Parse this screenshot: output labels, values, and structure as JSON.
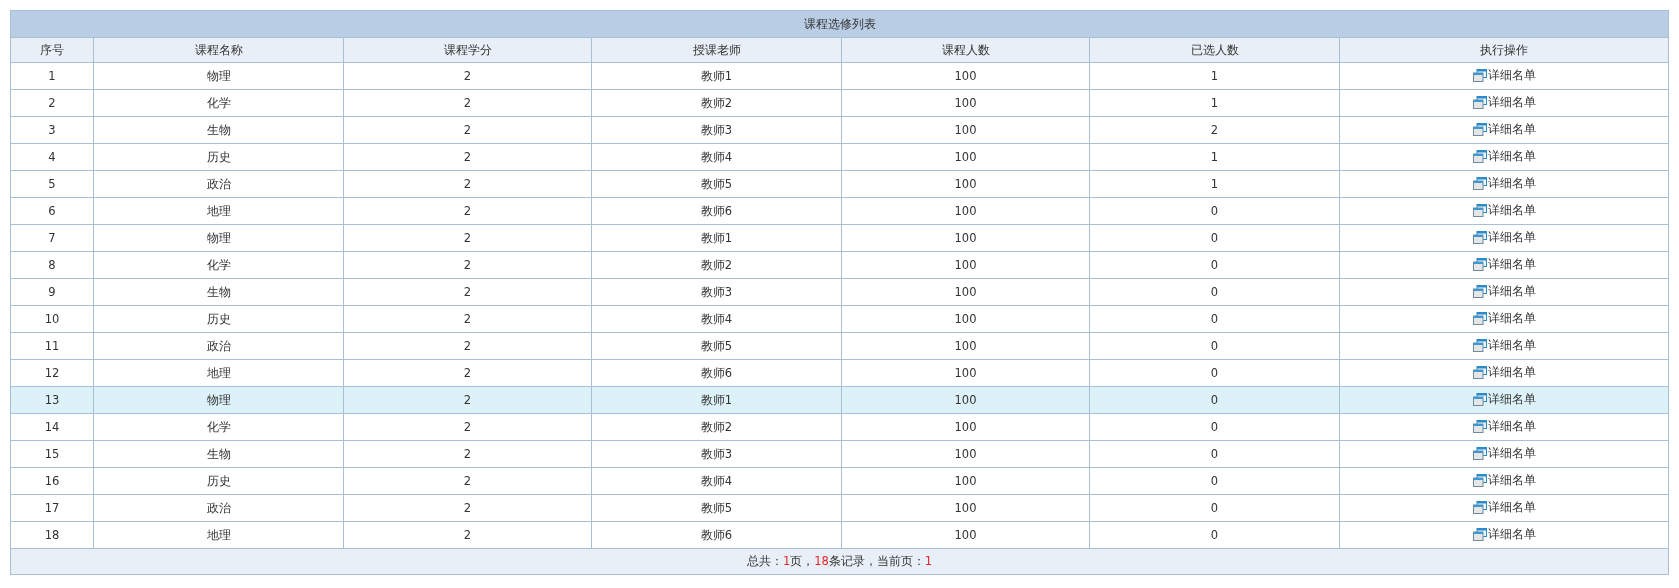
{
  "table": {
    "title": "课程选修列表",
    "columns": [
      "序号",
      "课程名称",
      "课程学分",
      "授课老师",
      "课程人数",
      "已选人数",
      "执行操作"
    ],
    "rows": [
      {
        "cells": [
          "1",
          "物理",
          "2",
          "教师1",
          "100",
          "1"
        ],
        "action": "详细名单",
        "highlighted": false
      },
      {
        "cells": [
          "2",
          "化学",
          "2",
          "教师2",
          "100",
          "1"
        ],
        "action": "详细名单",
        "highlighted": false
      },
      {
        "cells": [
          "3",
          "生物",
          "2",
          "教师3",
          "100",
          "2"
        ],
        "action": "详细名单",
        "highlighted": false
      },
      {
        "cells": [
          "4",
          "历史",
          "2",
          "教师4",
          "100",
          "1"
        ],
        "action": "详细名单",
        "highlighted": false
      },
      {
        "cells": [
          "5",
          "政治",
          "2",
          "教师5",
          "100",
          "1"
        ],
        "action": "详细名单",
        "highlighted": false
      },
      {
        "cells": [
          "6",
          "地理",
          "2",
          "教师6",
          "100",
          "0"
        ],
        "action": "详细名单",
        "highlighted": false
      },
      {
        "cells": [
          "7",
          "物理",
          "2",
          "教师1",
          "100",
          "0"
        ],
        "action": "详细名单",
        "highlighted": false
      },
      {
        "cells": [
          "8",
          "化学",
          "2",
          "教师2",
          "100",
          "0"
        ],
        "action": "详细名单",
        "highlighted": false
      },
      {
        "cells": [
          "9",
          "生物",
          "2",
          "教师3",
          "100",
          "0"
        ],
        "action": "详细名单",
        "highlighted": false
      },
      {
        "cells": [
          "10",
          "历史",
          "2",
          "教师4",
          "100",
          "0"
        ],
        "action": "详细名单",
        "highlighted": false
      },
      {
        "cells": [
          "11",
          "政治",
          "2",
          "教师5",
          "100",
          "0"
        ],
        "action": "详细名单",
        "highlighted": false
      },
      {
        "cells": [
          "12",
          "地理",
          "2",
          "教师6",
          "100",
          "0"
        ],
        "action": "详细名单",
        "highlighted": false
      },
      {
        "cells": [
          "13",
          "物理",
          "2",
          "教师1",
          "100",
          "0"
        ],
        "action": "详细名单",
        "highlighted": true
      },
      {
        "cells": [
          "14",
          "化学",
          "2",
          "教师2",
          "100",
          "0"
        ],
        "action": "详细名单",
        "highlighted": false
      },
      {
        "cells": [
          "15",
          "生物",
          "2",
          "教师3",
          "100",
          "0"
        ],
        "action": "详细名单",
        "highlighted": false
      },
      {
        "cells": [
          "16",
          "历史",
          "2",
          "教师4",
          "100",
          "0"
        ],
        "action": "详细名单",
        "highlighted": false
      },
      {
        "cells": [
          "17",
          "政治",
          "2",
          "教师5",
          "100",
          "0"
        ],
        "action": "详细名单",
        "highlighted": false
      },
      {
        "cells": [
          "18",
          "地理",
          "2",
          "教师6",
          "100",
          "0"
        ],
        "action": "详细名单",
        "highlighted": false
      }
    ],
    "footer": [
      {
        "text": "总共：",
        "emphasis": false
      },
      {
        "text": "1",
        "emphasis": true
      },
      {
        "text": "页，",
        "emphasis": false
      },
      {
        "text": "18",
        "emphasis": true
      },
      {
        "text": "条记录，当前页：",
        "emphasis": false
      },
      {
        "text": "1",
        "emphasis": true
      }
    ]
  }
}
